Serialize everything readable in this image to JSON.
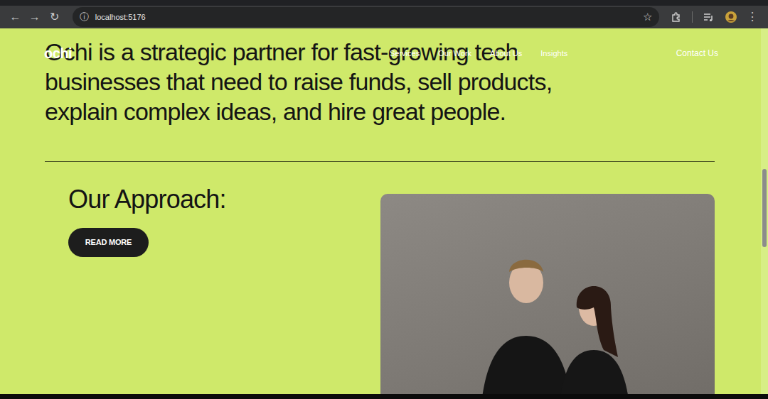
{
  "browser": {
    "back": "←",
    "forward": "→",
    "reload": "↻",
    "info": "ⓘ",
    "url": "localhost:5176",
    "star": "☆",
    "menu": "⋮"
  },
  "nav": {
    "logo": "ochi",
    "links": [
      "Services",
      "Our Work",
      "About Us",
      "Insights"
    ],
    "cta": "Contact Us"
  },
  "hero": {
    "lines": [
      "Ochi is a strategic partner for fast-growing tech",
      "businesses that need to raise funds, sell products,",
      "explain complex ideas, and hire great people."
    ]
  },
  "approach": {
    "title": "Our Approach:",
    "button": "READ MORE"
  },
  "scroll": {
    "level": 0.49
  }
}
